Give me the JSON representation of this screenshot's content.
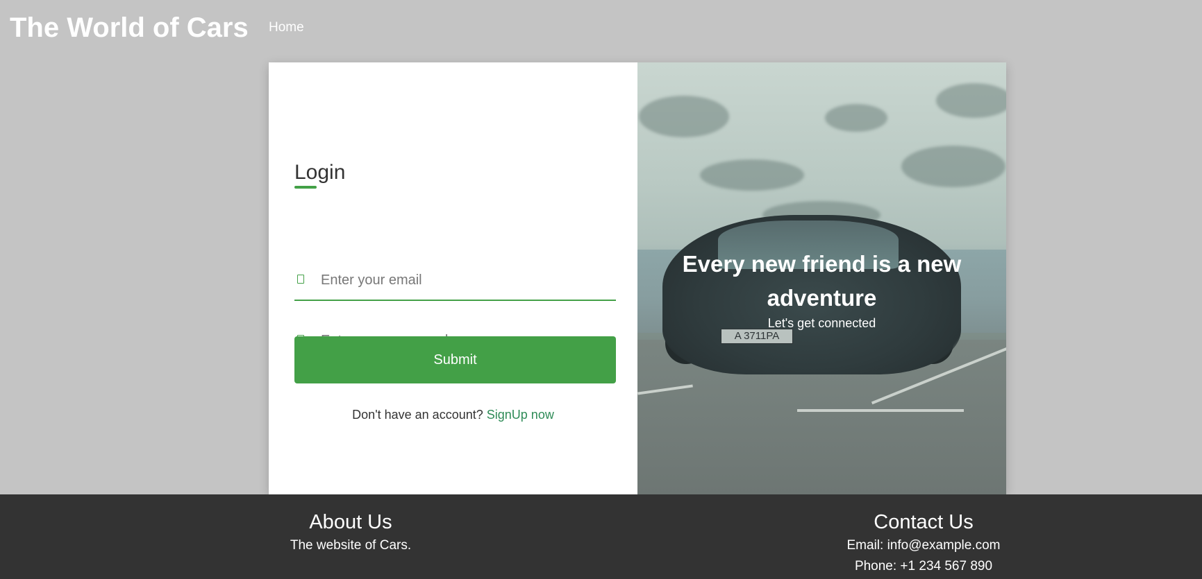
{
  "header": {
    "site_title": "The World of Cars",
    "nav_home": "Home"
  },
  "login": {
    "title": "Login",
    "email_placeholder": "Enter your email",
    "password_placeholder": "Enter your password",
    "submit_label": "Submit",
    "signup_prompt": "Don't have an account?",
    "signup_link": "SignUp now",
    "icons": [
      "envelope-icon",
      "lock-icon"
    ]
  },
  "hero": {
    "heading": "Every new friend is a new adventure",
    "subheading": "Let's get connected",
    "plate_text": "A 3711PA"
  },
  "footer": {
    "about_title": "About Us",
    "about_text": "The website of Cars.",
    "contact_title": "Contact Us",
    "contact_email": "Email: info@example.com",
    "contact_phone": "Phone: +1 234 567 890"
  },
  "colors": {
    "accent": "#43a047",
    "page_bg": "#c4c4c4",
    "footer_bg": "#333333",
    "link": "#2e8b57"
  }
}
